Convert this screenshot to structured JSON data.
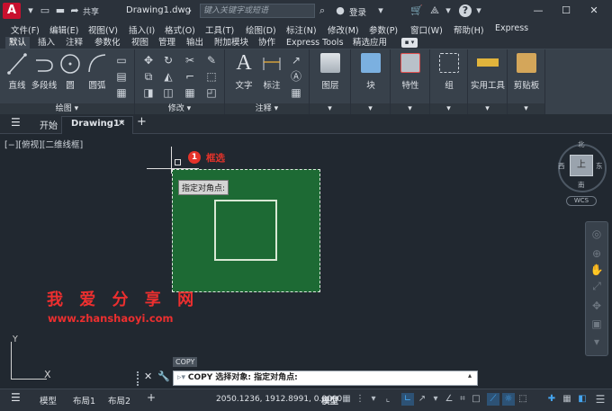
{
  "app": {
    "logo": "A",
    "doc_title": "Drawing1.dwg",
    "share_label": "共享",
    "search_placeholder": "键入关键字或短语",
    "login_label": "登录"
  },
  "menu": [
    "文件(F)",
    "编辑(E)",
    "视图(V)",
    "插入(I)",
    "格式(O)",
    "工具(T)",
    "绘图(D)",
    "标注(N)",
    "修改(M)",
    "参数(P)",
    "窗口(W)",
    "帮助(H)",
    "Express"
  ],
  "ribbon_tabs": [
    "默认",
    "插入",
    "注释",
    "参数化",
    "视图",
    "管理",
    "输出",
    "附加模块",
    "协作",
    "Express Tools",
    "精选应用"
  ],
  "ribbon": {
    "draw": {
      "title": "绘图",
      "line": "直线",
      "polyline": "多段线",
      "circle": "圆",
      "arc": "圆弧"
    },
    "modify": {
      "title": "修改"
    },
    "annotation": {
      "title": "注释",
      "text": "文字",
      "dimension": "标注"
    },
    "layers": "图层",
    "block": "块",
    "properties": "特性",
    "groups": "组",
    "utilities": "实用工具",
    "clipboard": "剪贴板"
  },
  "doc_tabs": {
    "start": "开始",
    "drawing": "Drawing1*"
  },
  "viewport": {
    "label": "[−][俯视][二维线框]",
    "tooltip": "指定对角点:",
    "step_number": "1",
    "step_label": "框选",
    "watermark_cn": "我 爱 分 享 网",
    "watermark_url": "www.zhanshaoyi.com"
  },
  "viewcube": {
    "top": "上",
    "north": "北",
    "south": "南",
    "east": "东",
    "west": "西",
    "wcs": "WCS"
  },
  "ucs": {
    "x": "X",
    "y": "Y"
  },
  "command": {
    "history": "COPY",
    "prompt": "COPY 选择对象: 指定对角点:"
  },
  "status": {
    "tabs": [
      "模型",
      "布局1",
      "布局2"
    ],
    "coords": "2050.1236, 1912.8991, 0.0000",
    "mode": "模型"
  },
  "colors": {
    "accent": "#45a5f0",
    "selection": "#1d6a34",
    "badge": "#e5332a",
    "logo": "#c8102e"
  }
}
